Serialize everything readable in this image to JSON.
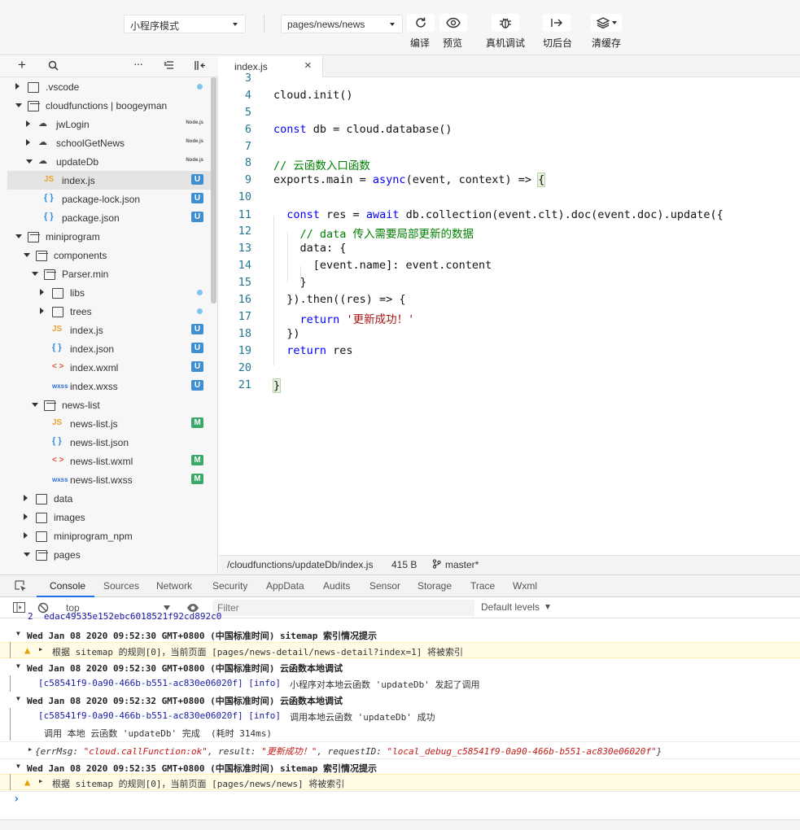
{
  "toolbar": {
    "mode_select": "小程序模式",
    "page_select": "pages/news/news",
    "buttons": [
      {
        "label": "编译",
        "icon": "refresh-icon"
      },
      {
        "label": "预览",
        "icon": "eye-icon"
      },
      {
        "label": "真机调试",
        "icon": "bug-icon"
      },
      {
        "label": "切后台",
        "icon": "switch-background-icon"
      },
      {
        "label": "清缓存",
        "icon": "layers-icon"
      }
    ]
  },
  "explorer": {
    "tree": [
      {
        "name": ".vscode",
        "type": "folder",
        "marker": "dot"
      },
      {
        "name": "cloudfunctions | boogeyman",
        "type": "cloud-root"
      },
      {
        "name": "jwLogin",
        "type": "cloud",
        "marker": "Node.js"
      },
      {
        "name": "schoolGetNews",
        "type": "cloud",
        "marker": "Node.js"
      },
      {
        "name": "updateDb",
        "type": "cloud",
        "marker": "Node.js"
      },
      {
        "name": "index.js",
        "type": "js",
        "marker": "U"
      },
      {
        "name": "package-lock.json",
        "type": "json",
        "marker": "U"
      },
      {
        "name": "package.json",
        "type": "json",
        "marker": "U"
      },
      {
        "name": "miniprogram",
        "type": "folder"
      },
      {
        "name": "components",
        "type": "folder"
      },
      {
        "name": "Parser.min",
        "type": "folder"
      },
      {
        "name": "libs",
        "type": "folder",
        "marker": "dot"
      },
      {
        "name": "trees",
        "type": "folder",
        "marker": "dot"
      },
      {
        "name": "index.js",
        "type": "js",
        "marker": "U"
      },
      {
        "name": "index.json",
        "type": "json",
        "marker": "U"
      },
      {
        "name": "index.wxml",
        "type": "wxml",
        "marker": "U"
      },
      {
        "name": "index.wxss",
        "type": "wxss",
        "marker": "U"
      },
      {
        "name": "news-list",
        "type": "folder"
      },
      {
        "name": "news-list.js",
        "type": "js",
        "marker": "M"
      },
      {
        "name": "news-list.json",
        "type": "json"
      },
      {
        "name": "news-list.wxml",
        "type": "wxml",
        "marker": "M"
      },
      {
        "name": "news-list.wxss",
        "type": "wxss",
        "marker": "M"
      },
      {
        "name": "data",
        "type": "folder"
      },
      {
        "name": "images",
        "type": "folder"
      },
      {
        "name": "miniprogram_npm",
        "type": "folder"
      },
      {
        "name": "pages",
        "type": "folder"
      }
    ]
  },
  "editor": {
    "tab_label": "index.js",
    "line_numbers": [
      "3",
      "4",
      "5",
      "6",
      "7",
      "8",
      "9",
      "10",
      "11",
      "12",
      "13",
      "14",
      "15",
      "16",
      "17",
      "18",
      "19",
      "20",
      "21"
    ]
  },
  "statusbar": {
    "path": "/cloudfunctions/updateDb/index.js",
    "size": "415 B",
    "branch": "master*"
  },
  "devtools": {
    "tabs": [
      "Console",
      "Sources",
      "Network",
      "Security",
      "AppData",
      "Audits",
      "Sensor",
      "Storage",
      "Trace",
      "Wxml"
    ],
    "context": "top",
    "filter_placeholder": "Filter",
    "levels": "Default levels"
  },
  "console": {
    "top_cut": "2  edac49535e152ebc6018521f92cd892c0",
    "g1": "Wed Jan 08 2020 09:52:30 GMT+0800 (中国标准时间) sitemap 索引情况提示",
    "w1": "根据 sitemap 的规则[0]，当前页面 [pages/news-detail/news-detail?index=1] 将被索引",
    "g2": "Wed Jan 08 2020 09:52:30 GMT+0800 (中国标准时间) 云函数本地调试",
    "l2_id": "[c58541f9-0a90-466b-b551-ac830e06020f] [info]",
    "l2_msg": "小程序对本地云函数 'updateDb' 发起了调用",
    "g3": "Wed Jan 08 2020 09:52:32 GMT+0800 (中国标准时间) 云函数本地调试",
    "l3_id": "[c58541f9-0a90-466b-b551-ac830e06020f] [info]",
    "l3_msg": "调用本地云函数 'updateDb' 成功",
    "l3b": "调用 本地 云函数 'updateDb' 完成  (耗时 314ms)",
    "obj_a": "{errMsg: ",
    "obj_b": "\"cloud.callFunction:ok\"",
    "obj_c": ", result: ",
    "obj_d": "\"更新成功！\"",
    "obj_e": ", requestID: ",
    "obj_f": "\"local_debug_c58541f9-0a90-466b-b551-ac830e06020f\"",
    "obj_g": "}",
    "g4": "Wed Jan 08 2020 09:52:35 GMT+0800 (中国标准时间) sitemap 索引情况提示",
    "w4": "根据 sitemap 的规则[0]，当前页面 [pages/news/news] 将被索引",
    "prompt": "›"
  }
}
